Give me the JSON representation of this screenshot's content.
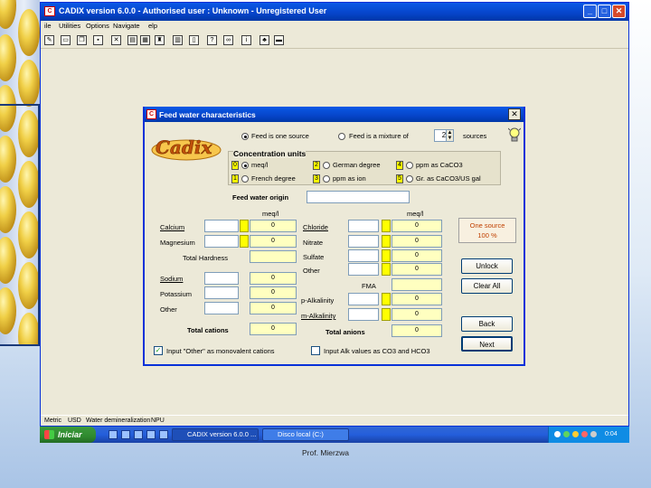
{
  "window": {
    "title": "CADIX version 6.0.0  -  Authorised user : Unknown - Unregistered User",
    "app_icon": "C",
    "buttons": {
      "minimize": "_",
      "maximize": "□",
      "close": "✕"
    }
  },
  "menu": [
    "ile",
    "Utilities",
    "Options",
    "Navigate",
    "elp"
  ],
  "toolbar_icons": [
    "edit-icon",
    "open-icon",
    "copy-icon",
    "save-icon",
    "delete-icon",
    "chart-icon",
    "image-icon",
    "tank-icon",
    "table-icon",
    "book-icon",
    "help-icon",
    "glasses-icon",
    "info-icon",
    "plant-icon",
    "truck-icon"
  ],
  "dialog": {
    "title": "Feed water characteristics",
    "close": "✕",
    "logo": "Cadix",
    "source_one": "Feed is one source",
    "source_mixture": "Feed is a mixture of",
    "source_count": "2",
    "sources_label": "sources",
    "units_title": "Concentration units",
    "units": [
      {
        "num": "0",
        "label": "meq/l",
        "selected": true
      },
      {
        "num": "1",
        "label": "French degree",
        "selected": false
      },
      {
        "num": "2",
        "label": "German degree",
        "selected": false
      },
      {
        "num": "3",
        "label": "ppm as ion",
        "selected": false
      },
      {
        "num": "4",
        "label": "ppm as CaCO3",
        "selected": false
      },
      {
        "num": "5",
        "label": "Gr. as CaCO3/US gal",
        "selected": false
      }
    ],
    "origin_label": "Feed water origin",
    "origin_value": "",
    "col_header_left": "meq/l",
    "col_header_right": "meq/l",
    "cations": [
      {
        "name": "Calcium",
        "value": "0"
      },
      {
        "name": "Magnesium",
        "value": "0"
      },
      {
        "name": "Sodium",
        "value": "0"
      },
      {
        "name": "Potassium",
        "value": "0"
      },
      {
        "name": "Other",
        "value": "0"
      }
    ],
    "total_hardness": "Total Hardness",
    "total_cations": "Total cations",
    "total_cations_value": "0",
    "anions": [
      {
        "name": "Chloride",
        "value": "0"
      },
      {
        "name": "Nitrate",
        "value": "0"
      },
      {
        "name": "Sulfate",
        "value": "0"
      },
      {
        "name": "Other",
        "value": "0"
      }
    ],
    "fma": "FMA",
    "p_alk": "p-Alkalinity",
    "p_alk_value": "0",
    "m_alk": "m-Alkalinity",
    "m_alk_value": "0",
    "total_anions": "Total anions",
    "total_anions_value": "0",
    "source_info_line1": "One source",
    "source_info_line2": "100  %",
    "buttons": {
      "unlock": "Unlock",
      "clear_all": "Clear All",
      "back": "Back",
      "next": "Next"
    },
    "check_other": "Input \"Other\" as monovalent cations",
    "check_other_checked": true,
    "check_alk": "Input Alk values as CO3 and HCO3",
    "check_alk_checked": false
  },
  "status": {
    "metric": "Metric",
    "usd": "USD",
    "module": "Water demineralization",
    "npu": "NPU"
  },
  "taskbar": {
    "start": "Iniciar",
    "tasks": [
      "CADIX version 6.0.0 ...",
      "Disco local (C:)"
    ],
    "clock": "0:04"
  },
  "footer": "Prof. Mierzwa",
  "colors": {
    "titlebar": "#0a59e6",
    "yellow": "#ffff00",
    "start": "#3c9a3c"
  }
}
